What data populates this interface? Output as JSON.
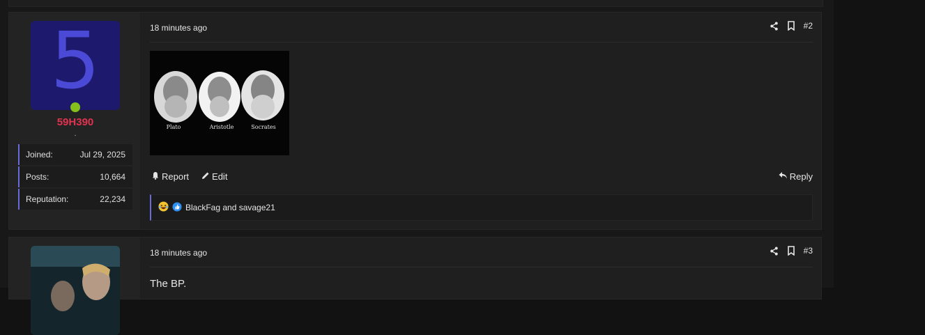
{
  "posts": [
    {
      "number": "#2",
      "timestamp": "18 minutes ago",
      "user": {
        "avatar_letter": "5",
        "username": "59H390",
        "title": ".",
        "status": "online",
        "stats": [
          {
            "label": "Joined:",
            "value": "Jul 29, 2025"
          },
          {
            "label": "Posts:",
            "value": "10,664"
          },
          {
            "label": "Reputation:",
            "value": "22,234"
          }
        ]
      },
      "image": {
        "captions": [
          "Plato",
          "Aristotle",
          "Socrates"
        ]
      },
      "actions": {
        "report": "Report",
        "edit": "Edit",
        "reply": "Reply"
      },
      "reactions": {
        "icons": [
          "laughing-emoji-icon",
          "thumbs-up-icon"
        ],
        "text": "BlackFag and savage21"
      }
    },
    {
      "number": "#3",
      "timestamp": "18 minutes ago",
      "body": "The BP."
    }
  ],
  "colors": {
    "username": "#e0334f",
    "accent": "#6a6ad8",
    "online": "#86c11b",
    "avatar_bg": "#1d1a6e",
    "avatar_fg": "#4a4ad6"
  }
}
